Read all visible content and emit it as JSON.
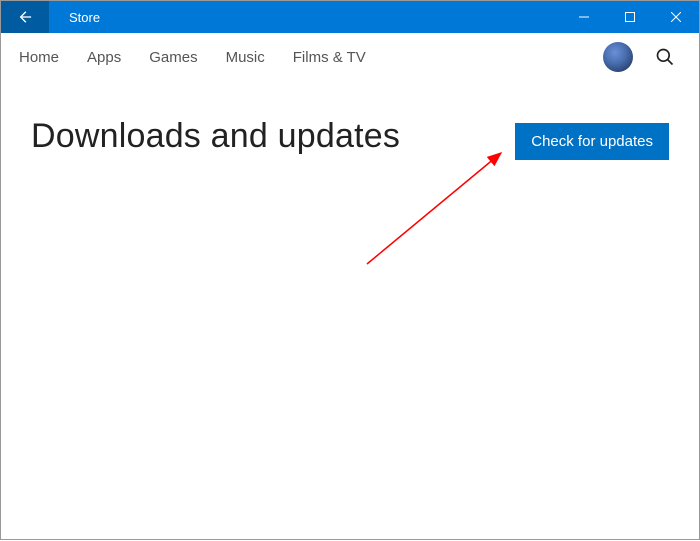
{
  "titlebar": {
    "title": "Store"
  },
  "nav": {
    "items": [
      {
        "label": "Home"
      },
      {
        "label": "Apps"
      },
      {
        "label": "Games"
      },
      {
        "label": "Music"
      },
      {
        "label": "Films & TV"
      }
    ]
  },
  "page": {
    "title": "Downloads and updates",
    "check_button": "Check for updates"
  },
  "colors": {
    "titlebar_bg": "#0078d7",
    "back_bg": "#005ba1",
    "primary_button_bg": "#0072c6",
    "arrow_color": "#ff0000"
  }
}
